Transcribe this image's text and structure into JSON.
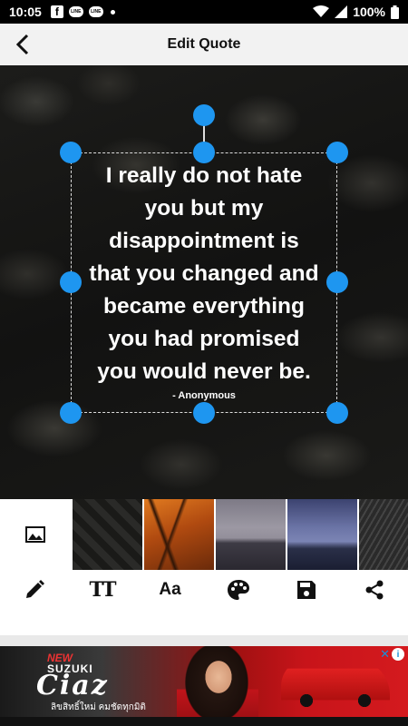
{
  "status_bar": {
    "time": "10:05",
    "notifications": [
      "facebook-icon",
      "line-icon",
      "line-icon"
    ],
    "battery": "100%"
  },
  "header": {
    "title": "Edit Quote",
    "back_icon": "chevron-left-icon"
  },
  "quote": {
    "lines": [
      "I really do not hate",
      "you but my",
      "disappointment is",
      "that you changed and",
      "became everything",
      "you had promised",
      "you would never be."
    ],
    "author": "- Anonymous",
    "handle_color": "#1e96f0"
  },
  "backgrounds": {
    "gallery_icon": "image-icon",
    "thumbnails": [
      "dark-snakeskin",
      "orange-grass",
      "misty-forest",
      "blue-foggy-hills",
      "dark-texture"
    ]
  },
  "toolbar": {
    "tools": [
      {
        "name": "edit-text",
        "icon": "pencil-icon"
      },
      {
        "name": "text-size",
        "icon": "text-size-icon",
        "glyph": "TT"
      },
      {
        "name": "font",
        "icon": "font-icon",
        "glyph": "Aa"
      },
      {
        "name": "color",
        "icon": "palette-icon"
      },
      {
        "name": "save",
        "icon": "save-icon"
      },
      {
        "name": "share",
        "icon": "share-icon"
      }
    ]
  },
  "ad": {
    "new": "NEW",
    "brand": "SUZUKI",
    "model": "Ciaz",
    "tagline": "ลิขสิทธิ์ใหม่ คมชัดทุกมิติ",
    "adchoices": "i",
    "close": "✕"
  }
}
